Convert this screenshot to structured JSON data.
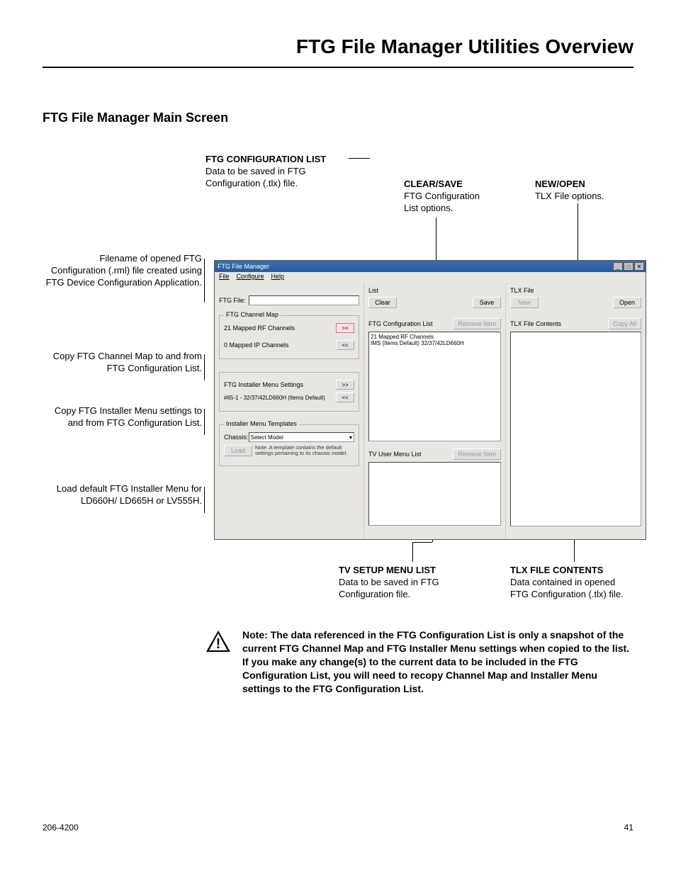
{
  "page_title": "FTG File Manager Utilities Overview",
  "section_title": "FTG File Manager Main Screen",
  "callouts": {
    "ftg_config_list": {
      "title": "FTG CONFIGURATION LIST",
      "body1": "Data to be saved in FTG",
      "body2": "Configuration (.tlx) file."
    },
    "clear_save": {
      "title": "CLEAR/SAVE",
      "body1": "FTG Configuration",
      "body2": "List options."
    },
    "new_open": {
      "title": "NEW/OPEN",
      "body": "TLX File options."
    },
    "filename": "Filename of opened FTG Configuration (.rml) file created using FTG Device Configuration Application.",
    "copy_map": "Copy FTG Channel Map to and from FTG Configuration List.",
    "copy_installer": "Copy FTG Installer Menu settings to and from FTG Configuration List.",
    "load_default": "Load default FTG Installer Menu for LD660H/ LD665H or LV555H.",
    "tv_setup": {
      "title": "TV SETUP MENU LIST",
      "body1": "Data to be saved in FTG",
      "body2": "Configuration file."
    },
    "tlx_contents": {
      "title": "TLX FILE CONTENTS",
      "body1": "Data contained in opened",
      "body2": "FTG Configuration (.tlx) file."
    }
  },
  "window": {
    "title": "FTG File Manager",
    "menu": {
      "file": "File",
      "configure": "Configure",
      "help": "Help"
    },
    "left": {
      "ftg_file_label": "FTG File:",
      "grp_channel_map": "FTG Channel Map",
      "rf_channels": "21 Mapped RF Channels",
      "ip_channels": "0 Mapped IP Channels",
      "grp_installer": "FTG Installer Menu Settings",
      "installer_line": "#65-1 - 32/37/42LD660H (Items Default)",
      "grp_templates": "Installer Menu Templates",
      "chassis_label": "Chassis:",
      "chassis_value": "Select Model",
      "load_btn": "Load",
      "template_note": "Note: A template contains the default settings pertaining to its chassis model."
    },
    "mid": {
      "list_label": "List",
      "clear_btn": "Clear",
      "save_btn": "Save",
      "config_list_label": "FTG Configuration List",
      "remove_btn": "Remove Item",
      "list_line1": "21 Mapped RF Channels",
      "list_line2": "IMS (Items Default) 32/37/42LD660H",
      "tv_menu_label": "TV User Menu List",
      "remove_btn2": "Remove Item"
    },
    "right": {
      "tlx_label": "TLX File",
      "new_btn": "New",
      "open_btn": "Open",
      "contents_label": "TLX File Contents",
      "copyall_btn": "Copy All"
    }
  },
  "note": "Note: The data referenced in the FTG Configuration List is only a snapshot of the current FTG Channel Map and FTG Installer Menu settings when copied to the list. If you make any change(s) to the current data to be included in the FTG Configuration List, you will need to recopy Channel Map and Installer Menu settings to the FTG Configuration List.",
  "footer_left": "206-4200",
  "footer_right": "41"
}
